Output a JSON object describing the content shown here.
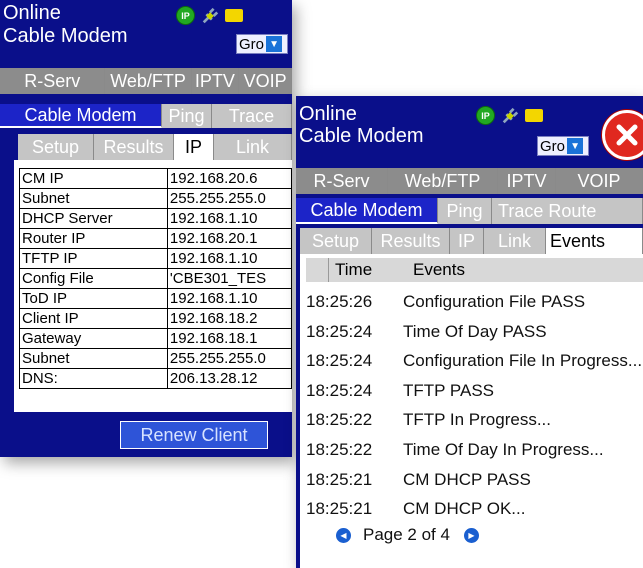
{
  "back": {
    "status_line1": "Online",
    "status_line2": "Cable Modem",
    "ip_icon_text": "IP",
    "group_value": "Gro",
    "tabs_row1": [
      "R-Serv",
      "Web/FTP",
      "IPTV",
      "VOIP"
    ],
    "tabs_row2": [
      "Cable Modem",
      "Ping",
      "Trace"
    ],
    "tabs_row3": [
      "Setup",
      "Results",
      "IP",
      "Link"
    ],
    "ip_rows": [
      {
        "label": "CM IP",
        "value": "192.168.20.6"
      },
      {
        "label": "Subnet",
        "value": "255.255.255.0"
      },
      {
        "label": "DHCP Server",
        "value": "192.168.1.10"
      },
      {
        "label": "Router IP",
        "value": "192.168.20.1"
      },
      {
        "label": "TFTP IP",
        "value": "192.168.1.10"
      },
      {
        "label": "Config File",
        "value": "'CBE301_TES"
      },
      {
        "label": "ToD IP",
        "value": "192.168.1.10"
      },
      {
        "label": "Client IP",
        "value": "192.168.18.2"
      },
      {
        "label": "Gateway",
        "value": "192.168.18.1"
      },
      {
        "label": "Subnet",
        "value": "255.255.255.0"
      },
      {
        "label": "DNS:",
        "value": "206.13.28.12"
      }
    ],
    "renew_label": "Renew Client"
  },
  "front": {
    "status_line1": "Online",
    "status_line2": "Cable Modem",
    "ip_icon_text": "IP",
    "group_value": "Gro",
    "tabs_row1": [
      "R-Serv",
      "Web/FTP",
      "IPTV",
      "VOIP"
    ],
    "tabs_row2": [
      "Cable Modem",
      "Ping",
      "Trace Route"
    ],
    "tabs_row3": [
      "Setup",
      "Results",
      "IP",
      "Link",
      "Events"
    ],
    "events_header": {
      "time": "Time",
      "events": "Events"
    },
    "events": [
      {
        "time": "18:25:26",
        "text": "Configuration File  PASS"
      },
      {
        "time": "18:25:24",
        "text": "Time Of Day  PASS"
      },
      {
        "time": "18:25:24",
        "text": "Configuration File In Progress..."
      },
      {
        "time": "18:25:24",
        "text": "TFTP  PASS"
      },
      {
        "time": "18:25:22",
        "text": "TFTP In Progress..."
      },
      {
        "time": "18:25:22",
        "text": "Time Of Day In Progress..."
      },
      {
        "time": "18:25:21",
        "text": "CM DHCP  PASS"
      },
      {
        "time": "18:25:21",
        "text": "CM DHCP OK..."
      }
    ],
    "pager_text": "Page 2 of 4"
  },
  "icons": {
    "ip": "ip-status-icon",
    "plug": "plug-icon",
    "folder": "folder-icon",
    "close": "close-icon",
    "dropdown": "chevron-down-icon",
    "prev": "previous-page-icon",
    "next": "next-page-icon"
  },
  "colors": {
    "screen_bg": "#0a0f8a",
    "tab_gray": "#8c8c8c",
    "tab_blue": "#1c24c8",
    "close_red": "#e0281f",
    "ip_green": "#22a822",
    "folder_yellow": "#f3d600"
  }
}
